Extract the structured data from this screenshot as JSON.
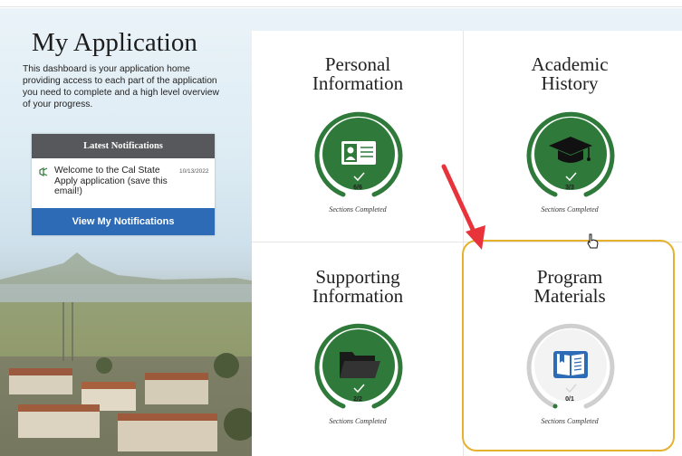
{
  "page": {
    "title": "My Application",
    "intro": "This dashboard is your application home providing access to each part of the application you need to complete and a high level overview of your progress."
  },
  "notifications": {
    "header": "Latest Notifications",
    "items": [
      {
        "text": "Welcome to the Cal State Apply application (save this email!)",
        "date": "10/13/2022"
      }
    ],
    "button_label": "View My Notifications"
  },
  "tiles": [
    {
      "title": [
        "Personal",
        "Information"
      ],
      "count": "6/6",
      "caption": "Sections Completed",
      "icon": "id-card-icon",
      "progress": 1.0,
      "status": "complete"
    },
    {
      "title": [
        "Academic",
        "History"
      ],
      "count": "3/3",
      "caption": "Sections Completed",
      "icon": "graduation-cap-icon",
      "progress": 1.0,
      "status": "complete"
    },
    {
      "title": [
        "Supporting",
        "Information"
      ],
      "count": "2/2",
      "caption": "Sections Completed",
      "icon": "folder-icon",
      "progress": 1.0,
      "status": "complete"
    },
    {
      "title": [
        "Program",
        "Materials"
      ],
      "count": "0/1",
      "caption": "Sections Completed",
      "icon": "book-icon",
      "progress": 0.0,
      "status": "incomplete"
    }
  ],
  "colors": {
    "complete": "#2f7a3a",
    "incomplete_ring": "#cfcfcf",
    "book_fill": "#2e6bb7",
    "notif_button": "#2e6bb7",
    "highlight": "#e6b12f",
    "arrow": "#e8333a"
  }
}
